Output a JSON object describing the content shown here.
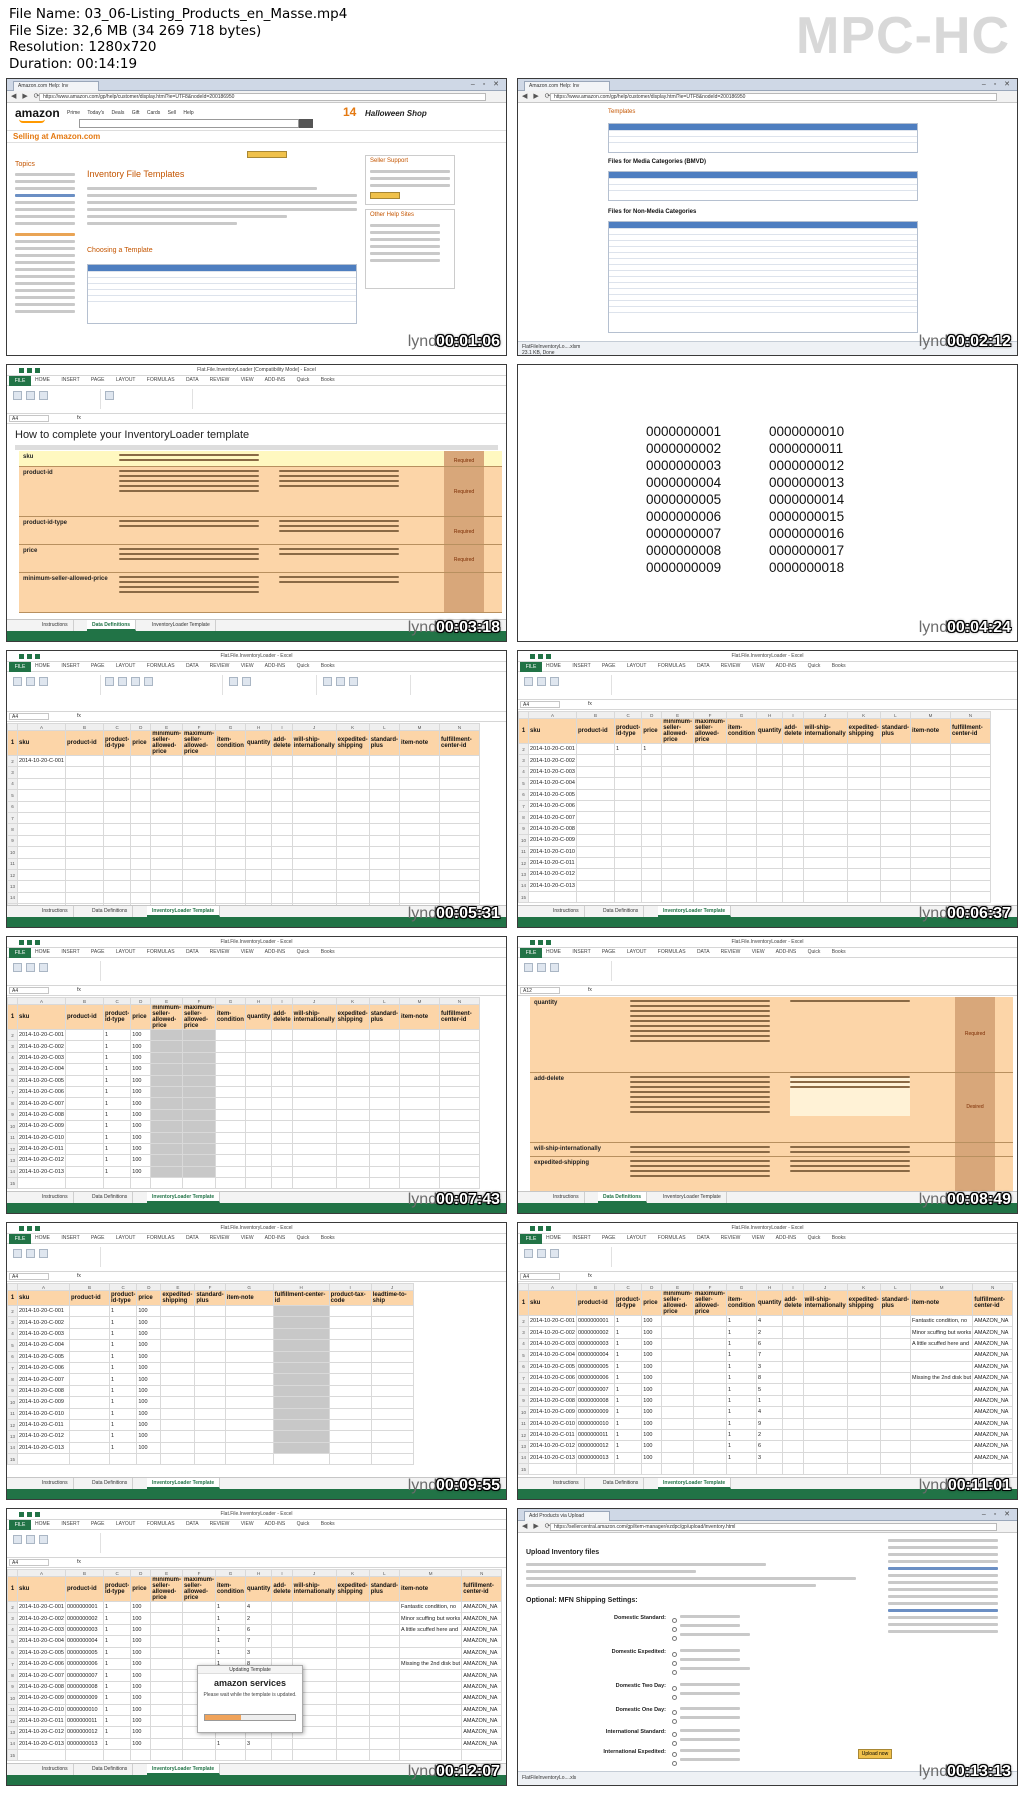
{
  "meta": {
    "file_name": "File Name: 03_06-Listing_Products_en_Masse.mp4",
    "file_size": "File Size: 32,6 MB (34 269 718 bytes)",
    "resolution": "Resolution: 1280x720",
    "duration": "Duration: 00:14:19"
  },
  "player_logo": "MPC-HC",
  "watermark": "lynda",
  "timestamps": [
    "00:01:06",
    "00:02:12",
    "00:03:18",
    "00:04:24",
    "00:05:31",
    "00:06:37",
    "00:07:43",
    "00:08:49",
    "00:09:55",
    "00:11:01",
    "00:12:07",
    "00:13:13"
  ],
  "frame1": {
    "tab": "Amazon.com Help: Inv",
    "url": "https://www.amazon.com/gp/help/customer/display.html?ie=UTF8&nodeId=200186950",
    "logo": "amazon",
    "nav": "Prime   Today's Deals   Gift Cards   Sell   Help",
    "sell_heading": "Selling at Amazon.com",
    "topics": "Topics",
    "page_title": "Inventory File Templates",
    "seller_support": "Seller Support",
    "other_help": "Other Help Sites",
    "choosing": "Choosing a Template",
    "badge": "14",
    "halloween": "Halloween Shop"
  },
  "frame2": {
    "url": "https://www.amazon.com/gp/help/customer/display.html?ie=UTF8&nodeId=200186950",
    "templates": "Templates",
    "media_heading": "Files for Media Categories (BMVD)",
    "nonmedia_heading": "Files for Non-Media Categories",
    "download_file": "FlatFileInventoryLo....xlsm",
    "download_size": "23.1 KB, Done"
  },
  "frame3": {
    "title": "Flat.File.InventoryLoader [Compatibility Mode] - Excel",
    "sheet_title": "How to complete your InventoryLoader template",
    "rows": [
      "sku",
      "product-id",
      "product-id-type",
      "price",
      "minimum-seller-allowed-price"
    ],
    "required": "Required"
  },
  "frame4": {
    "col1": [
      "0000000001",
      "0000000002",
      "0000000003",
      "0000000004",
      "0000000005",
      "0000000006",
      "0000000007",
      "0000000008",
      "0000000009"
    ],
    "col2": [
      "0000000010",
      "0000000011",
      "0000000012",
      "0000000013",
      "0000000014",
      "0000000015",
      "0000000016",
      "0000000017",
      "0000000018"
    ]
  },
  "excel": {
    "title": "Flat.File.InventoryLoader - Excel",
    "ribbon_tabs": "HOME   INSERT   PAGE LAYOUT   FORMULAS   DATA   REVIEW   VIEW   ADD-INS   Quick Books",
    "file_tab": "FILE",
    "sheet_tabs": [
      "Instructions",
      "Data Definitions",
      "InventoryLoader Template"
    ],
    "headers_a": [
      "sku",
      "product-id",
      "product-id-type",
      "price",
      "minimum-seller-allowed-price",
      "maximum-seller-allowed-price",
      "item-condition",
      "quantity",
      "add-delete",
      "will-ship-internationally",
      "expedited-shipping",
      "standard-plus",
      "item-note",
      "fulfillment-center-id"
    ],
    "headers_b": [
      "sku",
      "product-id",
      "product-id-type",
      "price",
      "expedited-shipping",
      "standard-plus",
      "item-note",
      "fulfillment-center-id",
      "product-tax-code",
      "leadtime-to-ship"
    ],
    "skus": [
      "2014-10-20-C-001",
      "2014-10-20-C-002",
      "2014-10-20-C-003",
      "2014-10-20-C-004",
      "2014-10-20-C-005",
      "2014-10-20-C-006",
      "2014-10-20-C-007",
      "2014-10-20-C-008",
      "2014-10-20-C-009",
      "2014-10-20-C-010",
      "2014-10-20-C-011",
      "2014-10-20-C-012",
      "2014-10-20-C-013"
    ],
    "product_ids": [
      "0000000001",
      "0000000002",
      "0000000003",
      "0000000004",
      "0000000005",
      "0000000006",
      "0000000007",
      "0000000008",
      "0000000009",
      "0000000010",
      "0000000011",
      "0000000012",
      "0000000013"
    ],
    "product_id_type": "1",
    "price": "100",
    "fulfillment": "AMAZON_NA",
    "notes": [
      "Fantastic condition, no",
      "Minor scuffing but works",
      "A little scuffed here and",
      "",
      "",
      "Missing the 2nd disk but",
      ""
    ],
    "quantities": [
      "4",
      "2",
      "6",
      "7",
      "3",
      "8",
      "5",
      "1",
      "4",
      "9",
      "2",
      "6",
      "3"
    ],
    "conditions": [
      "1",
      "1",
      "1",
      "1",
      "1",
      "1",
      "1",
      "1",
      "1",
      "1",
      "1",
      "1",
      "1"
    ]
  },
  "frame8": {
    "rows": [
      "quantity",
      "add-delete",
      "will-ship-internationally",
      "expedited-shipping"
    ],
    "required": "Required",
    "desirable": "Desired"
  },
  "frame11": {
    "dialog_title": "Updating Template",
    "dialog_logo": "amazon services",
    "dialog_msg": "Please wait while the template is updated.",
    "progress": 0.4
  },
  "frame12": {
    "tab": "Add Products via Upload",
    "url": "https://sellercentral.amazon.com/gp/item-manager/ezdpc/gp/upload/inventory.html",
    "heading": "Upload Inventory files",
    "shipping_heading": "Optional: MFN Shipping Settings:",
    "options": [
      "Domestic Standard:",
      "Domestic Expedited:",
      "Domestic Two Day:",
      "Domestic One Day:",
      "International Standard:",
      "International Expedited:"
    ],
    "upload_btn": "Upload now",
    "download_file": "FlatFileInventoryLo....xls"
  }
}
